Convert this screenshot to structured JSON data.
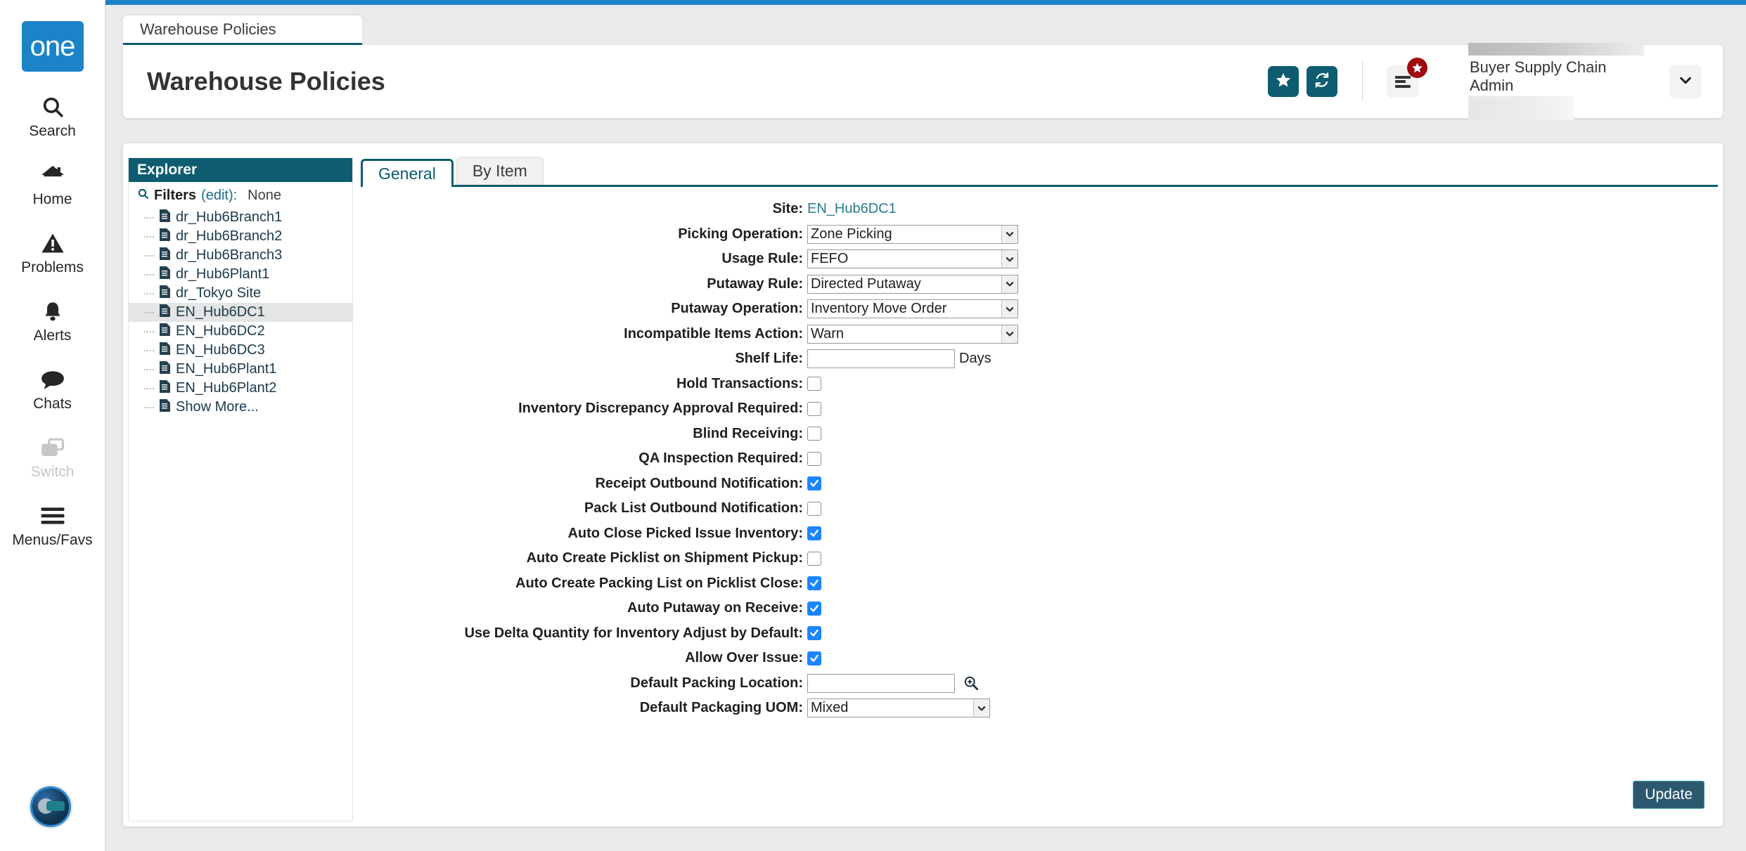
{
  "brand": {
    "logo_text": "one"
  },
  "rail": {
    "items": [
      {
        "label": "Search",
        "icon": "search-icon",
        "disabled": false
      },
      {
        "label": "Home",
        "icon": "home-icon",
        "disabled": false
      },
      {
        "label": "Problems",
        "icon": "warning-icon",
        "disabled": false
      },
      {
        "label": "Alerts",
        "icon": "bell-icon",
        "disabled": false
      },
      {
        "label": "Chats",
        "icon": "chat-icon",
        "disabled": false
      },
      {
        "label": "Switch",
        "icon": "switch-icon",
        "disabled": true
      },
      {
        "label": "Menus/Favs",
        "icon": "hamburger-icon",
        "disabled": false
      }
    ],
    "assistant_orb": "assistant-avatar-icon"
  },
  "browser_tab": {
    "label": "Warehouse Policies"
  },
  "header": {
    "title": "Warehouse Policies",
    "favorite_button": "star-icon",
    "refresh_button": "refresh-icon",
    "menu_button": "menu-icon",
    "menu_badge": "star-badge-icon",
    "user_role": "Buyer Supply Chain Admin",
    "user_caret": "chevron-down-icon"
  },
  "explorer": {
    "title": "Explorer",
    "filters_label": "Filters",
    "filters_edit": "(edit):",
    "filters_value": "None",
    "items": [
      {
        "label": "dr_Hub6Branch1",
        "selected": false
      },
      {
        "label": "dr_Hub6Branch2",
        "selected": false
      },
      {
        "label": "dr_Hub6Branch3",
        "selected": false
      },
      {
        "label": "dr_Hub6Plant1",
        "selected": false
      },
      {
        "label": "dr_Tokyo Site",
        "selected": false
      },
      {
        "label": "EN_Hub6DC1",
        "selected": true
      },
      {
        "label": "EN_Hub6DC2",
        "selected": false
      },
      {
        "label": "EN_Hub6DC3",
        "selected": false
      },
      {
        "label": "EN_Hub6Plant1",
        "selected": false
      },
      {
        "label": "EN_Hub6Plant2",
        "selected": false
      },
      {
        "label": "Show More...",
        "selected": false
      }
    ]
  },
  "tabs": [
    {
      "label": "General",
      "active": true
    },
    {
      "label": "By Item",
      "active": false
    }
  ],
  "form": {
    "site": {
      "label": "Site:",
      "value": "EN_Hub6DC1",
      "type": "link"
    },
    "selects": [
      {
        "label": "Picking Operation:",
        "value": "Zone Picking",
        "width": "wide"
      },
      {
        "label": "Usage Rule:",
        "value": "FEFO",
        "width": "wide"
      },
      {
        "label": "Putaway Rule:",
        "value": "Directed Putaway",
        "width": "wide"
      },
      {
        "label": "Putaway Operation:",
        "value": "Inventory Move Order",
        "width": "wide"
      },
      {
        "label": "Incompatible Items Action:",
        "value": "Warn",
        "width": "wide"
      }
    ],
    "shelf_life": {
      "label": "Shelf Life:",
      "value": "",
      "units": "Days"
    },
    "checkboxes": [
      {
        "label": "Hold Transactions:",
        "checked": false
      },
      {
        "label": "Inventory Discrepancy Approval Required:",
        "checked": false
      },
      {
        "label": "Blind Receiving:",
        "checked": false
      },
      {
        "label": "QA Inspection Required:",
        "checked": false
      },
      {
        "label": "Receipt Outbound Notification:",
        "checked": true
      },
      {
        "label": "Pack List Outbound Notification:",
        "checked": false
      },
      {
        "label": "Auto Close Picked Issue Inventory:",
        "checked": true
      },
      {
        "label": "Auto Create Picklist on Shipment Pickup:",
        "checked": false
      },
      {
        "label": "Auto Create Packing List on Picklist Close:",
        "checked": true
      },
      {
        "label": "Auto Putaway on Receive:",
        "checked": true
      },
      {
        "label": "Use Delta Quantity for Inventory Adjust by Default:",
        "checked": true
      },
      {
        "label": "Allow Over Issue:",
        "checked": true
      }
    ],
    "packing_location": {
      "label": "Default Packing Location:",
      "value": "",
      "lookup_icon": "magnifier-plus-icon"
    },
    "packaging_uom": {
      "label": "Default Packaging UOM:",
      "value": "Mixed"
    }
  },
  "footer": {
    "update_label": "Update"
  },
  "colors": {
    "teal": "#0d5c70",
    "blue": "#1b84c8",
    "link": "#2a7a8c",
    "checkbox_on": "#1a85ff",
    "badge_red": "#9e0b0f",
    "update_bg": "#2c5970"
  }
}
